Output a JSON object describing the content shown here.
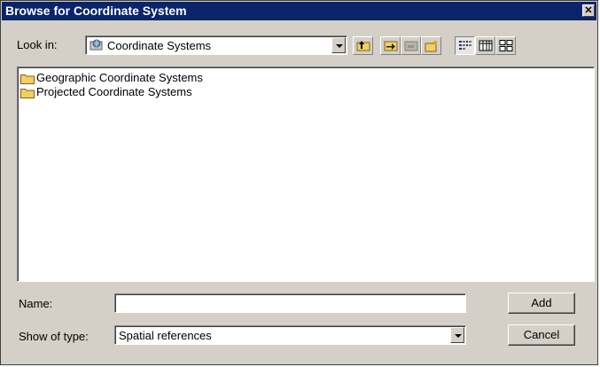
{
  "window": {
    "title": "Browse for Coordinate System",
    "close_glyph": "✕"
  },
  "lookin": {
    "label": "Look in:",
    "value": "Coordinate Systems",
    "icon": "coordinate-folder-icon"
  },
  "toolbar": {
    "buttons": [
      {
        "name": "up-one-level",
        "icon": "up-folder-icon"
      },
      {
        "name": "connect-folder",
        "icon": "connect-folder-icon"
      },
      {
        "name": "disconnect-folder",
        "icon": "disconnect-folder-icon"
      },
      {
        "name": "new-folder",
        "icon": "new-folder-icon"
      },
      {
        "name": "list-view",
        "icon": "list-view-icon",
        "pressed": true
      },
      {
        "name": "details-view",
        "icon": "details-view-icon"
      },
      {
        "name": "thumbnails-view",
        "icon": "thumbnails-view-icon"
      }
    ]
  },
  "list": {
    "items": [
      {
        "label": "Geographic Coordinate Systems",
        "icon": "folder-icon"
      },
      {
        "label": "Projected Coordinate Systems",
        "icon": "folder-icon"
      }
    ]
  },
  "name": {
    "label": "Name:",
    "value": ""
  },
  "type": {
    "label": "Show of type:",
    "value": "Spatial references"
  },
  "buttons": {
    "add": "Add",
    "cancel": "Cancel"
  },
  "colors": {
    "titlebar": "#0a246a",
    "face": "#d4d0c8",
    "folder": "#f0d060"
  }
}
